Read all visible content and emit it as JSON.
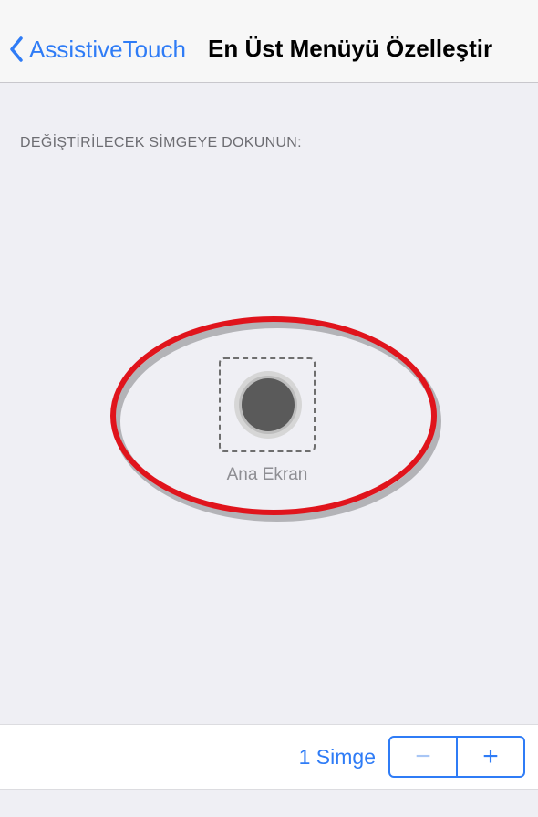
{
  "nav": {
    "back_label": "AssistiveTouch",
    "title": "En Üst Menüyü Özelleştir"
  },
  "section": {
    "header": "DEĞİŞTİRİLECEK SİMGEYE DOKUNUN:"
  },
  "icons": [
    {
      "label": "Ana Ekran",
      "icon": "home-button-icon"
    }
  ],
  "footer": {
    "count_label": "1 Simge",
    "minus": "−",
    "plus": "+"
  },
  "colors": {
    "accent": "#2f7cf6",
    "background": "#efeff4",
    "highlight": "#e0141c"
  }
}
